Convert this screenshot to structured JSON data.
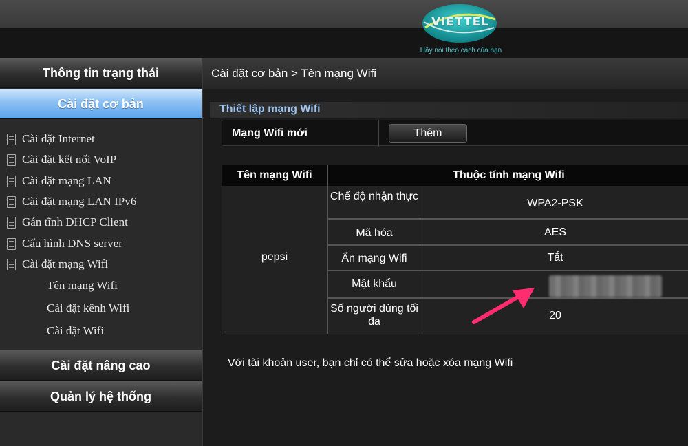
{
  "header": {
    "brand": "VIETTEL",
    "slogan": "Hãy nói theo cách của bạn",
    "brand_color": "#1aa3a3"
  },
  "sidebar": {
    "sections": [
      {
        "label": "Thông tin trạng thái",
        "active": false
      },
      {
        "label": "Cài đặt cơ bản",
        "active": true
      },
      {
        "label": "Cài đặt nâng cao",
        "active": false
      },
      {
        "label": "Quản lý hệ thống",
        "active": false
      }
    ],
    "items": [
      {
        "label": "Cài đặt Internet",
        "icon": "document-icon"
      },
      {
        "label": "Cài đặt kết nối VoIP",
        "icon": "document-icon"
      },
      {
        "label": "Cài đặt mạng LAN",
        "icon": "document-icon"
      },
      {
        "label": "Cài đặt mạng LAN IPv6",
        "icon": "document-icon"
      },
      {
        "label": "Gán tĩnh DHCP Client",
        "icon": "document-icon"
      },
      {
        "label": "Cấu hình DNS server",
        "icon": "document-icon"
      },
      {
        "label": "Cài đặt mạng Wifi",
        "icon": "document-icon"
      }
    ],
    "subitems": [
      {
        "label": "Tên mạng Wifi"
      },
      {
        "label": "Cài đặt kênh Wifi"
      },
      {
        "label": "Cài đặt Wifi"
      }
    ]
  },
  "main": {
    "breadcrumb": "Cài đặt cơ bản > Tên mạng Wifi",
    "section_title": "Thiết lập mạng Wifi",
    "new_network_label": "Mạng Wifi mới",
    "add_button": "Thêm",
    "table": {
      "col_ssid": "Tên mạng Wifi",
      "col_props": "Thuộc tính mạng Wifi",
      "ssid": "pepsi",
      "rows": [
        {
          "label": "Chế độ nhận thực",
          "value": "WPA2-PSK"
        },
        {
          "label": "Mã hóa",
          "value": "AES"
        },
        {
          "label": "Ẩn mạng Wifi",
          "value": "Tắt"
        },
        {
          "label": "Mật khẩu",
          "value": ""
        },
        {
          "label": "Số người dùng tối đa",
          "value": "20"
        }
      ]
    },
    "note": "Với tài khoản user, bạn chỉ có thể sửa hoặc xóa mạng Wifi"
  },
  "colors": {
    "active_nav": "#6aa9ec",
    "section_title": "#9dc3ee",
    "annotation_arrow": "#ff2d6f"
  }
}
